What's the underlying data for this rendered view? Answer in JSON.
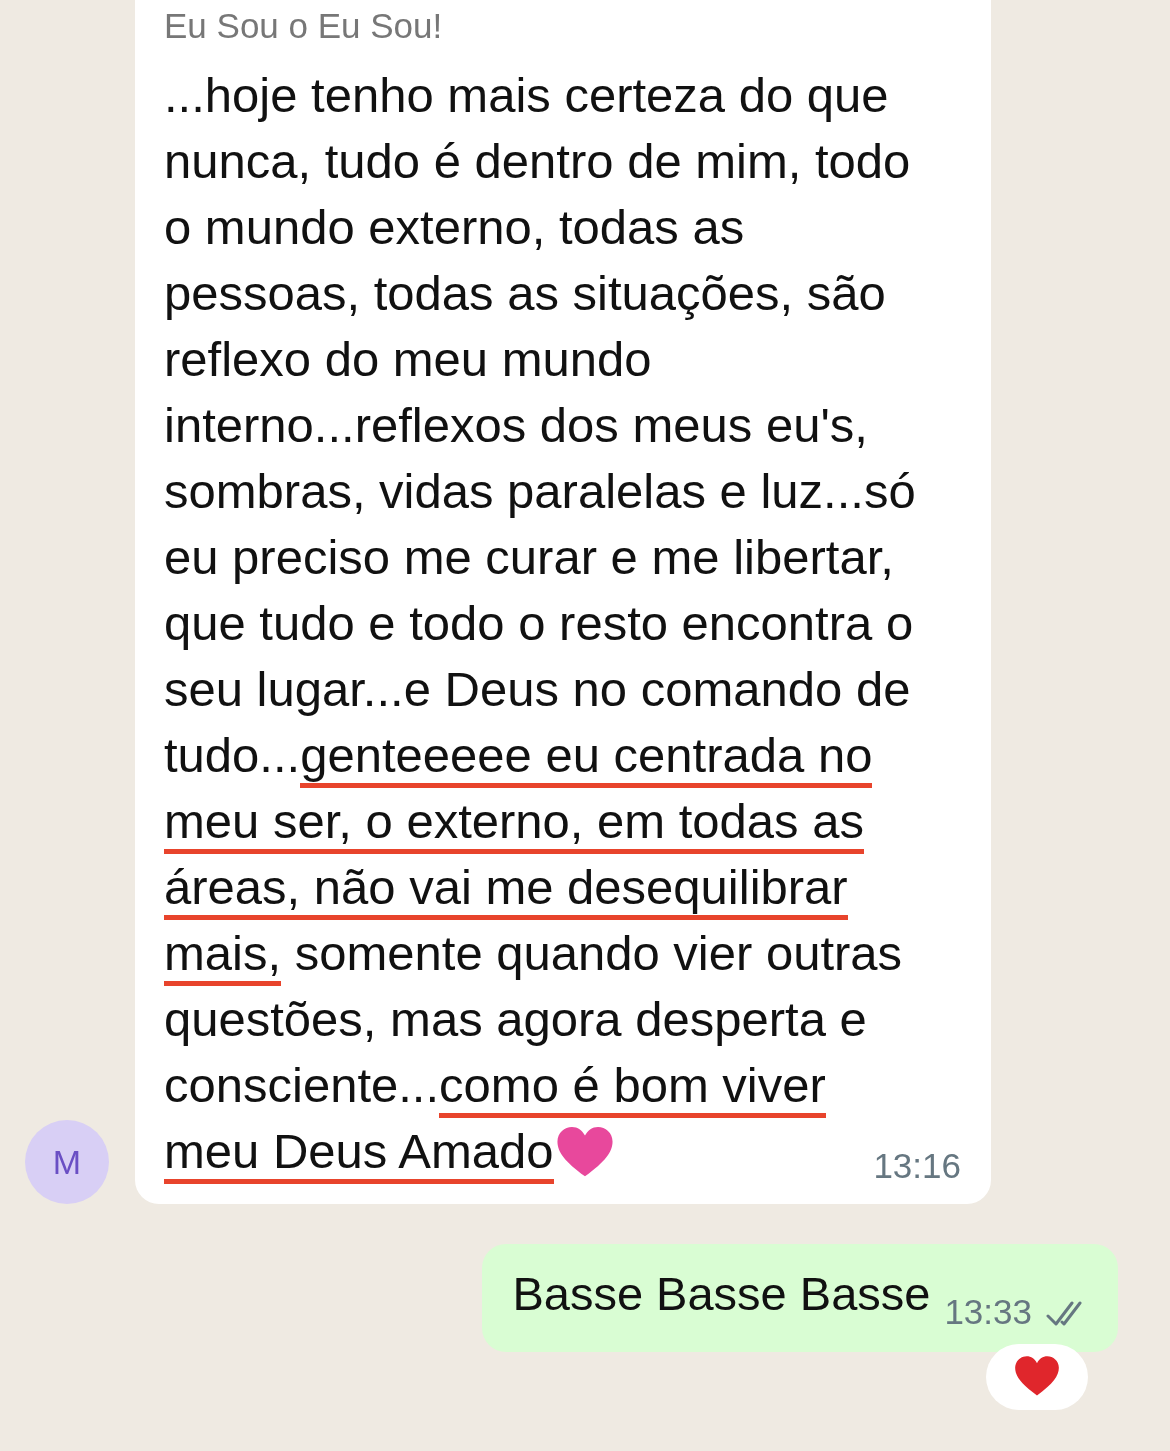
{
  "incoming": {
    "sender": "Eu Sou o Eu Sou!",
    "avatar": "M",
    "time": "13:16",
    "end_emoji": {
      "kind": "heart"
    },
    "lines": [
      [
        {
          "text": "...hoje tenho mais certeza do que",
          "underlined": false
        }
      ],
      [
        {
          "text": "nunca, tudo é dentro de mim, todo",
          "underlined": false
        }
      ],
      [
        {
          "text": "o mundo externo, todas as",
          "underlined": false
        }
      ],
      [
        {
          "text": "pessoas, todas as situações, são",
          "underlined": false
        }
      ],
      [
        {
          "text": "reflexo do meu mundo",
          "underlined": false
        }
      ],
      [
        {
          "text": "interno...reflexos dos meus eu's,",
          "underlined": false
        }
      ],
      [
        {
          "text": "sombras, vidas paralelas e luz...só",
          "underlined": false
        }
      ],
      [
        {
          "text": "eu preciso me curar e me libertar,",
          "underlined": false
        }
      ],
      [
        {
          "text": "que tudo e todo o resto encontra o",
          "underlined": false
        }
      ],
      [
        {
          "text": "seu lugar...e Deus no comando de",
          "underlined": false
        }
      ],
      [
        {
          "text": "tudo...",
          "underlined": false
        },
        {
          "text": "genteeeee eu centrada no",
          "underlined": true
        }
      ],
      [
        {
          "text": "meu ser, o externo, em todas as",
          "underlined": true
        }
      ],
      [
        {
          "text": "áreas, não vai me desequilibrar",
          "underlined": true
        }
      ],
      [
        {
          "text": "mais,",
          "underlined": true
        },
        {
          "text": " somente quando vier outras",
          "underlined": false
        }
      ],
      [
        {
          "text": "questões, mas agora desperta e",
          "underlined": false
        }
      ],
      [
        {
          "text": "consciente...",
          "underlined": false
        },
        {
          "text": "como é bom viver",
          "underlined": true
        }
      ],
      [
        {
          "text": "meu Deus Amado",
          "underlined": true
        }
      ]
    ]
  },
  "outgoing": {
    "text": "Basse Basse Basse",
    "time": "13:33",
    "read": false,
    "reaction": {
      "kind": "heart"
    }
  }
}
